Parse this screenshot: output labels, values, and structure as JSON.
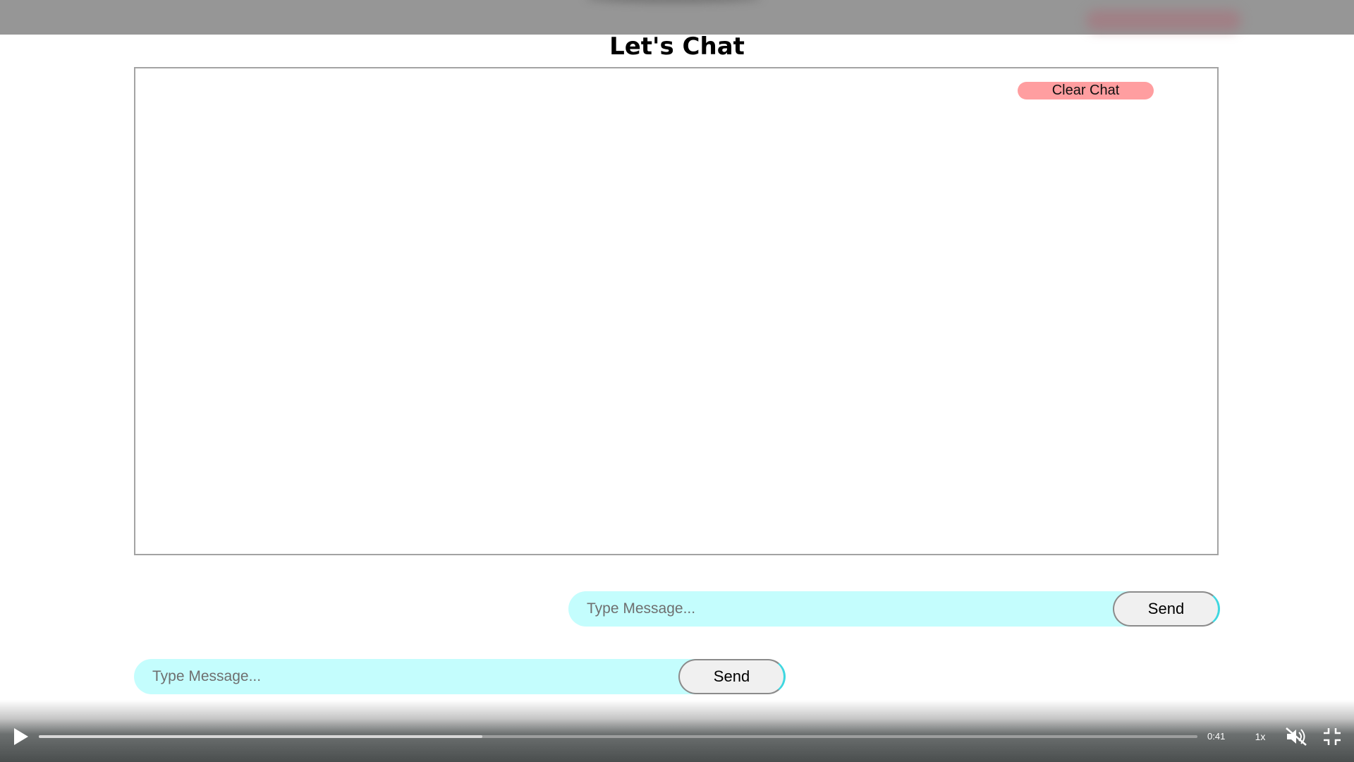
{
  "page": {
    "title": "Let's Chat"
  },
  "chat": {
    "clear_label": "Clear Chat",
    "messages": []
  },
  "composer_right": {
    "placeholder": "Type Message...",
    "value": "",
    "send_label": "Send"
  },
  "composer_left": {
    "placeholder": "Type Message...",
    "value": "",
    "send_label": "Send"
  },
  "player": {
    "time": "0:41",
    "speed": "1x",
    "progress": 0.383,
    "muted": true,
    "icons": {
      "play": "play-icon",
      "mute": "muted-speaker-icon",
      "fullscreen": "exit-fullscreen-icon"
    }
  },
  "colors": {
    "clear_button": "#ff9ea0",
    "input_bg": "#c4fdfd",
    "send_bg": "#f0f0f0",
    "send_accent": "#3fd7e0"
  }
}
